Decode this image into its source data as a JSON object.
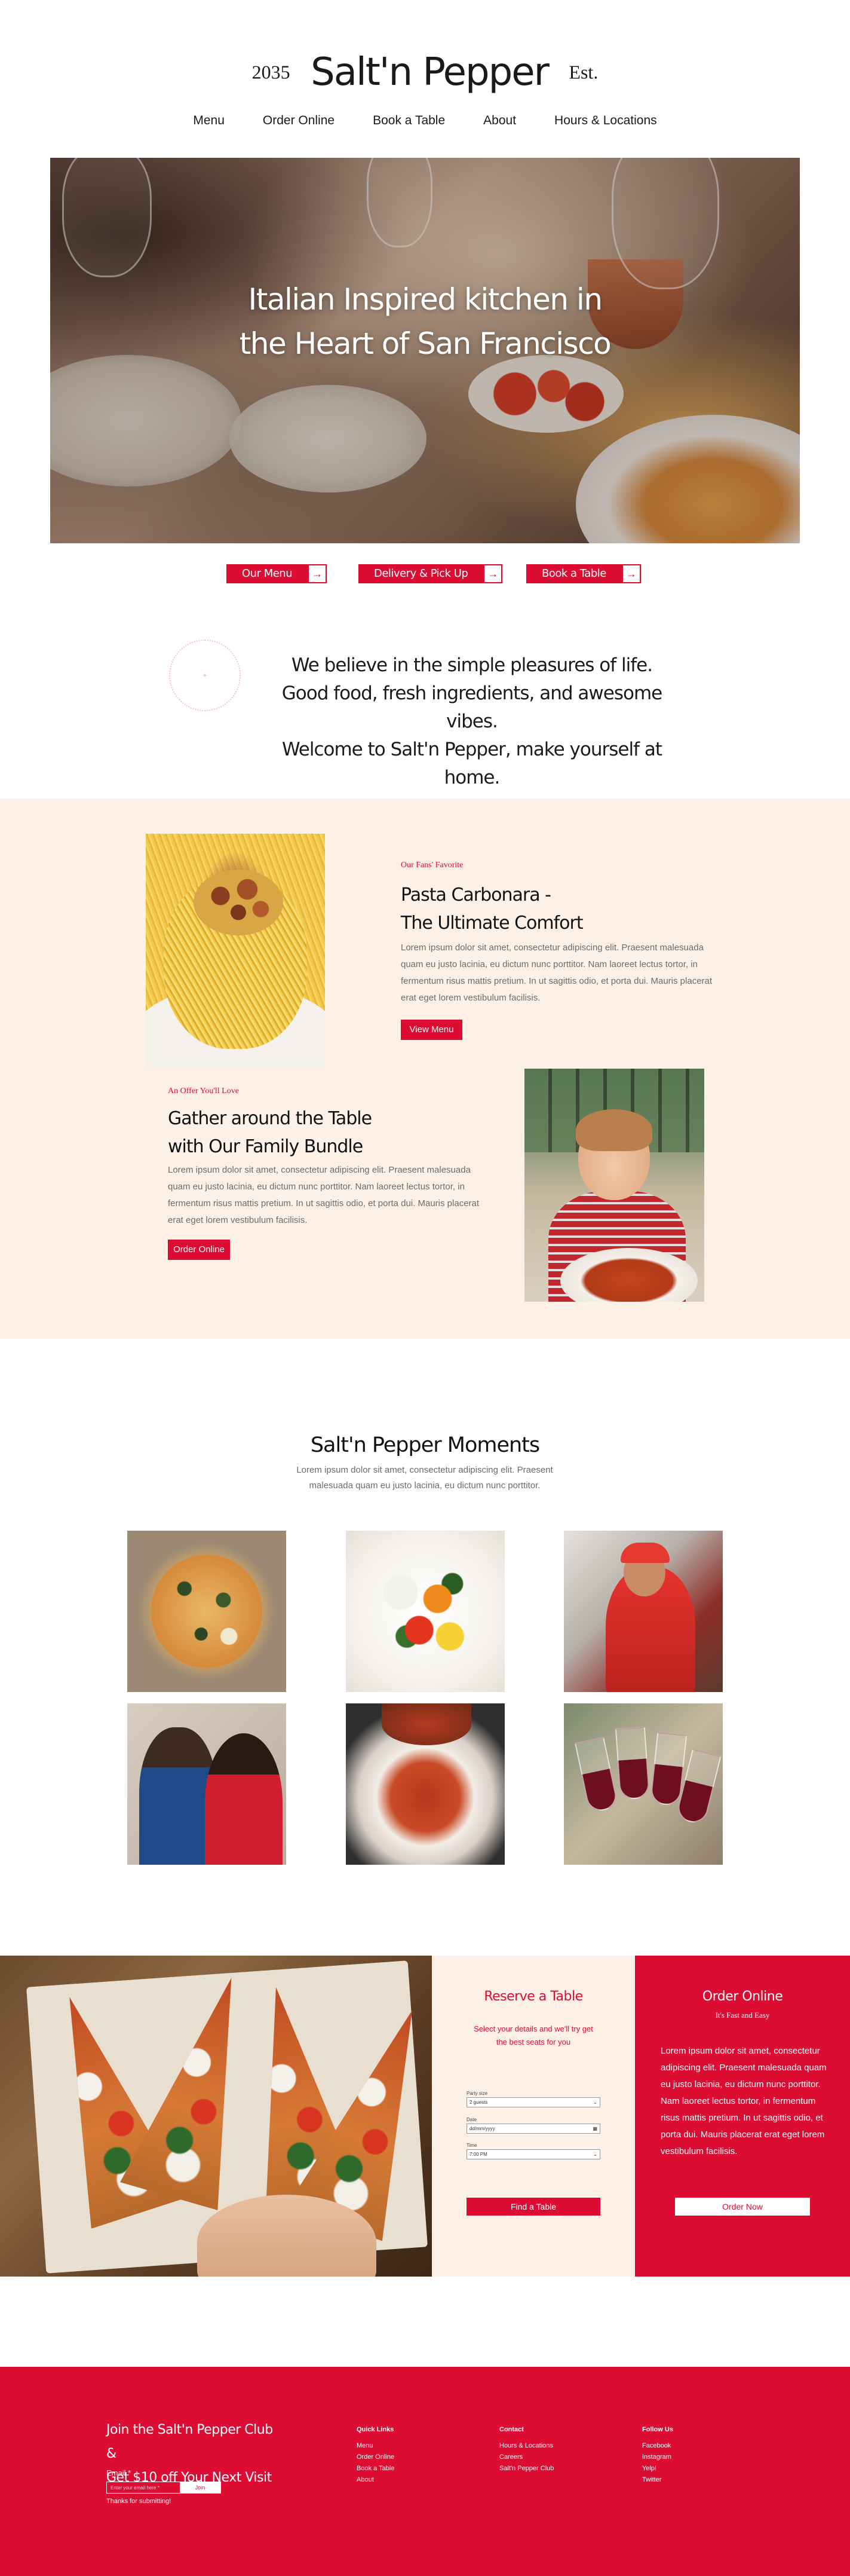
{
  "header": {
    "est_year": "2035",
    "brand_name": "Salt'n Pepper",
    "est_label": "Est."
  },
  "nav": {
    "items": [
      "Menu",
      "Order Online",
      "Book a Table",
      "About",
      "Hours & Locations"
    ]
  },
  "hero": {
    "headline_line1": "Italian Inspired kitchen in",
    "headline_line2": "the Heart of San Francisco"
  },
  "cta_buttons": [
    {
      "label": "Our Menu",
      "arrow": "→"
    },
    {
      "label": "Delivery & Pick Up",
      "arrow": "→"
    },
    {
      "label": "Book a Table",
      "arrow": "→"
    }
  ],
  "welcome": {
    "line1": "We believe in the simple pleasures of life.",
    "line2": "Good food, fresh ingredients, and awesome vibes.",
    "line3": "Welcome to Salt'n Pepper, make yourself at home."
  },
  "feature1": {
    "eyebrow": "Our Fans' Favorite",
    "title_line1": "Pasta Carbonara -",
    "title_line2": "The Ultimate Comfort",
    "body": "Lorem ipsum dolor sit amet, consectetur adipiscing elit. Praesent malesuada quam eu justo lacinia, eu dictum nunc porttitor. Nam laoreet lectus tortor, in fermentum risus mattis pretium. In ut sagittis odio, et porta dui. Mauris placerat erat eget lorem vestibulum facilisis.",
    "button": "View Menu"
  },
  "feature2": {
    "eyebrow": "An Offer You'll Love",
    "title_line1": "Gather around the Table",
    "title_line2": "with Our Family Bundle",
    "body": "Lorem ipsum dolor sit amet, consectetur adipiscing elit. Praesent malesuada quam eu justo lacinia, eu dictum nunc porttitor. Nam laoreet lectus tortor, in fermentum risus mattis pretium. In ut sagittis odio, et porta dui. Mauris placerat erat eget lorem vestibulum facilisis.",
    "button": "Order Online"
  },
  "moments": {
    "title": "Salt'n Pepper Moments",
    "subtitle": "Lorem ipsum dolor sit amet, consectetur adipiscing elit. Praesent malesuada quam eu justo lacinia, eu dictum nunc porttitor."
  },
  "reserve": {
    "title": "Reserve a Table",
    "subtitle": "Select your details and we'll try get the best seats for you",
    "party_label": "Party size",
    "party_value": "2 guests",
    "date_label": "Date",
    "date_value": "dd/mm/yyyy",
    "time_label": "Time",
    "time_value": "7:00 PM",
    "button": "Find a Table"
  },
  "order": {
    "title": "Order Online",
    "tagline": "It's Fast and Easy",
    "body": "Lorem ipsum dolor sit amet, consectetur adipiscing elit. Praesent malesuada quam eu justo lacinia, eu dictum nunc porttitor. Nam laoreet lectus tortor, in fermentum risus mattis pretium. In ut sagittis odio, et porta dui. Mauris placerat erat eget lorem vestibulum facilisis.",
    "button": "Order Now"
  },
  "footer": {
    "club_line1": "Join the Salt'n Pepper Club &",
    "club_line2": "Get $10 off Your Next Visit",
    "email_label": "Email *",
    "email_placeholder": "Enter your email here *",
    "join_button": "Join",
    "thanks": "Thanks for submitting!",
    "quick_links": {
      "heading": "Quick Links",
      "items": [
        "Menu",
        "Order Online",
        "Book a Table",
        "About"
      ]
    },
    "contact": {
      "heading": "Contact",
      "items": [
        "Hours & Locations",
        "Careers",
        "Salt'n Pepper Club"
      ]
    },
    "follow": {
      "heading": "Follow Us",
      "items": [
        "Facebook",
        "Instagram",
        "Yelp!",
        "Twitter"
      ]
    }
  },
  "colors": {
    "accent": "#dc0c33",
    "cream": "#fdf1e7"
  }
}
